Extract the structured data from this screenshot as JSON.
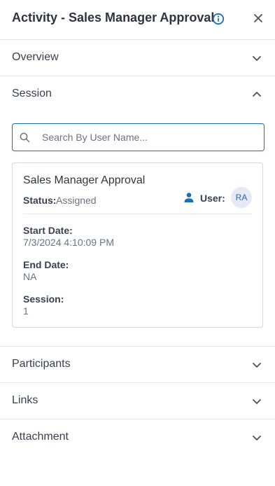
{
  "header": {
    "title": "Activity - Sales Manager Approval",
    "icons": {
      "info": "info-icon",
      "close": "close-icon"
    }
  },
  "sections": {
    "overview": {
      "label": "Overview",
      "expanded": false
    },
    "session": {
      "label": "Session",
      "expanded": true
    },
    "participants": {
      "label": "Participants",
      "expanded": false
    },
    "links": {
      "label": "Links",
      "expanded": false
    },
    "attachment": {
      "label": "Attachment",
      "expanded": false
    }
  },
  "session": {
    "search": {
      "placeholder": "Search By User Name...",
      "value": ""
    },
    "card": {
      "title": "Sales Manager Approval",
      "status_label": "Status:",
      "status_value": "Assigned",
      "user_label": "User:",
      "user_initials": "RA",
      "start_date_label": "Start Date:",
      "start_date_value": "7/3/2024 4:10:09 PM",
      "end_date_label": "End Date:",
      "end_date_value": "NA",
      "session_label": "Session:",
      "session_value": "1"
    }
  },
  "colors": {
    "accent": "#1a6fb5",
    "text": "#2f3441",
    "muted": "#6d7280",
    "divider": "#e3e5ea",
    "avatar_bg": "#e4e9f4"
  }
}
